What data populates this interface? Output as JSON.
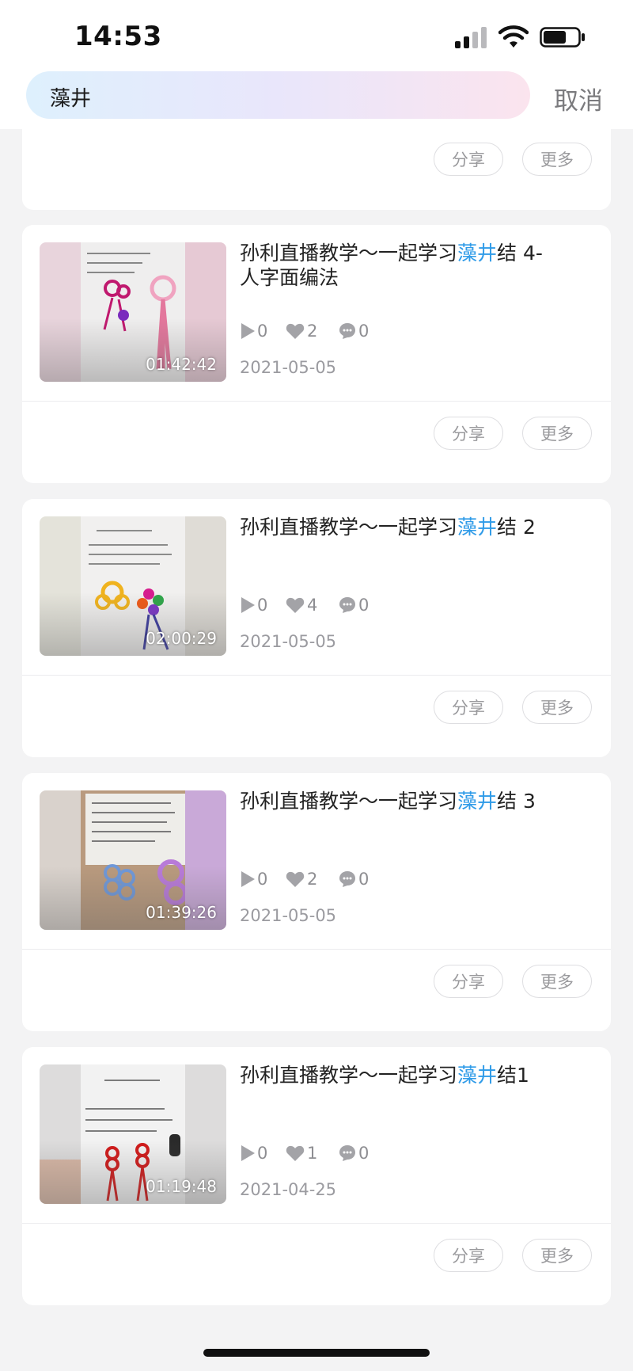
{
  "status_bar": {
    "time": "14:53"
  },
  "search": {
    "query": "藻井",
    "cancel_label": "取消"
  },
  "actions": {
    "share_label": "分享",
    "more_label": "更多"
  },
  "videos": [
    {
      "title_prefix": "孙利直播教学～一起学习",
      "title_highlight": "藻井",
      "title_suffix": "结 4-人字面编法",
      "plays": "0",
      "likes": "2",
      "comments": "0",
      "duration": "01:42:42",
      "date": "2021-05-05"
    },
    {
      "title_prefix": "孙利直播教学～一起学习",
      "title_highlight": "藻井",
      "title_suffix": "结 2",
      "plays": "0",
      "likes": "4",
      "comments": "0",
      "duration": "02:00:29",
      "date": "2021-05-05"
    },
    {
      "title_prefix": "孙利直播教学～一起学习",
      "title_highlight": "藻井",
      "title_suffix": "结 3",
      "plays": "0",
      "likes": "2",
      "comments": "0",
      "duration": "01:39:26",
      "date": "2021-05-05"
    },
    {
      "title_prefix": "孙利直播教学～一起学习",
      "title_highlight": "藻井",
      "title_suffix": "结1",
      "plays": "0",
      "likes": "1",
      "comments": "0",
      "duration": "01:19:48",
      "date": "2021-04-25"
    }
  ],
  "icons": {
    "play": "play-icon",
    "like": "heart-icon",
    "comment": "comment-icon"
  },
  "colors": {
    "highlight": "#2f9be8",
    "background": "#f3f3f4"
  }
}
